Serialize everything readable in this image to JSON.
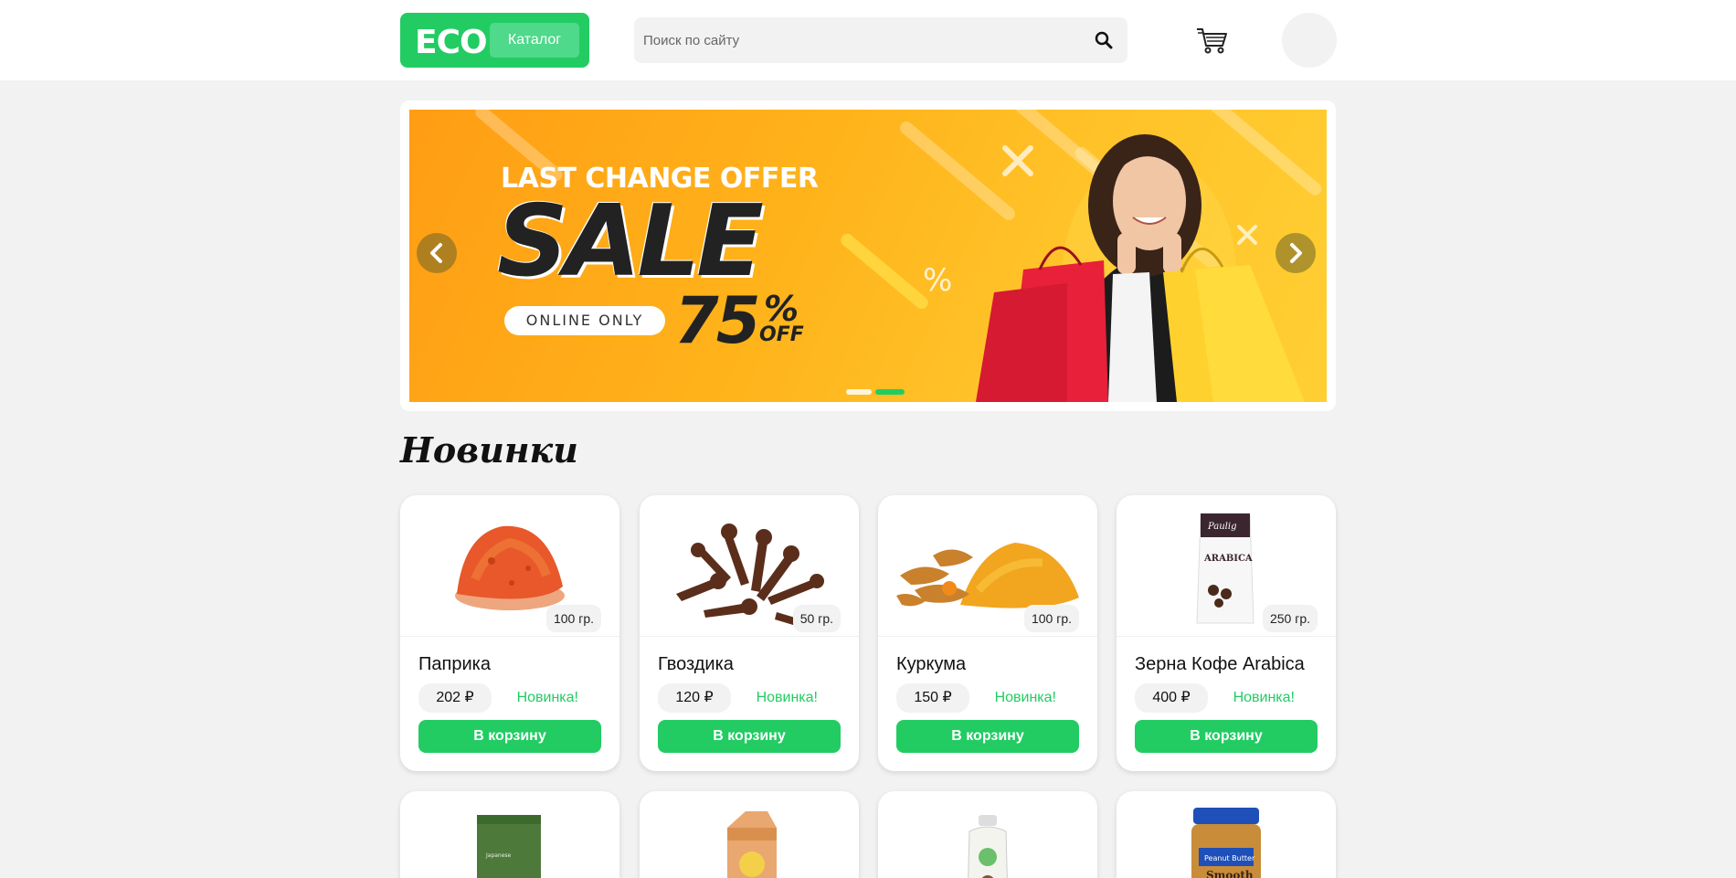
{
  "header": {
    "logo": "ECO",
    "catalog_label": "Каталог",
    "search_placeholder": "Поиск по сайту"
  },
  "banner": {
    "kicker": "LAST CHANGE OFFER",
    "headline": "SALE",
    "online": "ONLINE ONLY",
    "discount": "75",
    "discount_sign": "%",
    "off": "OFF"
  },
  "section": {
    "title": "Новинки"
  },
  "add_to_cart_label": "В корзину",
  "products": [
    {
      "name": "Паприка",
      "weight": "100 гр.",
      "price": "202 ₽",
      "badge": "Новинка!"
    },
    {
      "name": "Гвоздика",
      "weight": "50 гр.",
      "price": "120 ₽",
      "badge": "Новинка!"
    },
    {
      "name": "Куркума",
      "weight": "100 гр.",
      "price": "150 ₽",
      "badge": "Новинка!"
    },
    {
      "name": "Зерна Кофе Arabica",
      "weight": "250 гр.",
      "price": "400 ₽",
      "badge": "Новинка!"
    }
  ],
  "colors": {
    "accent": "#22cc63",
    "background": "#f2f2f2",
    "banner": "#ffb21a"
  }
}
